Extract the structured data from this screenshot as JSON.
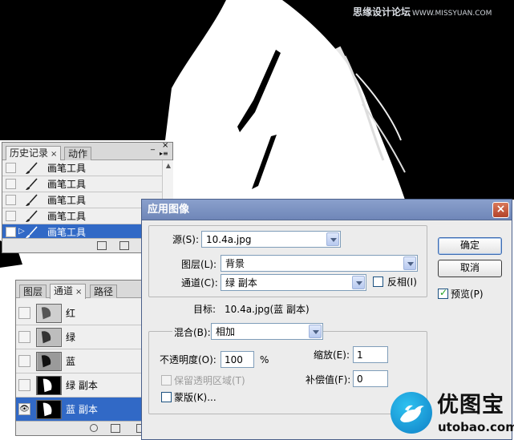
{
  "watermark": {
    "site_name": "思缘设计论坛",
    "site_url": "WWW.MISSYUAN.COM"
  },
  "history_panel": {
    "tabs": [
      {
        "label": "历史记录",
        "close": "×"
      },
      {
        "label": "动作"
      }
    ],
    "items": [
      {
        "label": "画笔工具"
      },
      {
        "label": "画笔工具"
      },
      {
        "label": "画笔工具"
      },
      {
        "label": "画笔工具"
      },
      {
        "label": "画笔工具"
      }
    ],
    "selected_index": 4
  },
  "channels_panel": {
    "tabs": [
      {
        "label": "图层"
      },
      {
        "label": "通道",
        "close": "×"
      },
      {
        "label": "路径"
      }
    ],
    "items": [
      {
        "label": "红"
      },
      {
        "label": "绿"
      },
      {
        "label": "蓝"
      },
      {
        "label": "绿 副本"
      },
      {
        "label": "蓝 副本"
      }
    ],
    "selected_index": 4
  },
  "dialog": {
    "title": "应用图像",
    "close": "×",
    "source_label": "源(S):",
    "source_value": "10.4a.jpg",
    "layer_label": "图层(L):",
    "layer_value": "背景",
    "channel_label": "通道(C):",
    "channel_value": "绿 副本",
    "invert_label": "反相(I)",
    "invert_checked": false,
    "target_label": "目标:",
    "target_value": "10.4a.jpg(蓝 副本)",
    "blending_label": "混合(B):",
    "blending_value": "相加",
    "opacity_label": "不透明度(O):",
    "opacity_value": "100",
    "opacity_unit": "%",
    "scale_label": "缩放(E):",
    "scale_value": "1",
    "offset_label": "补偿值(F):",
    "offset_value": "0",
    "preserve_label": "保留透明区域(T)",
    "preserve_checked": false,
    "mask_label": "蒙版(K)...",
    "mask_checked": false,
    "ok_label": "确定",
    "cancel_label": "取消",
    "preview_label": "预览(P)",
    "preview_checked": true,
    "tick": "✓"
  },
  "logo": {
    "name": "优图宝",
    "url": "utobao.com"
  },
  "colors": {
    "selection": "#3169c6",
    "title_bar": "#7890c2",
    "logo_blue": "#1aa3e0"
  }
}
